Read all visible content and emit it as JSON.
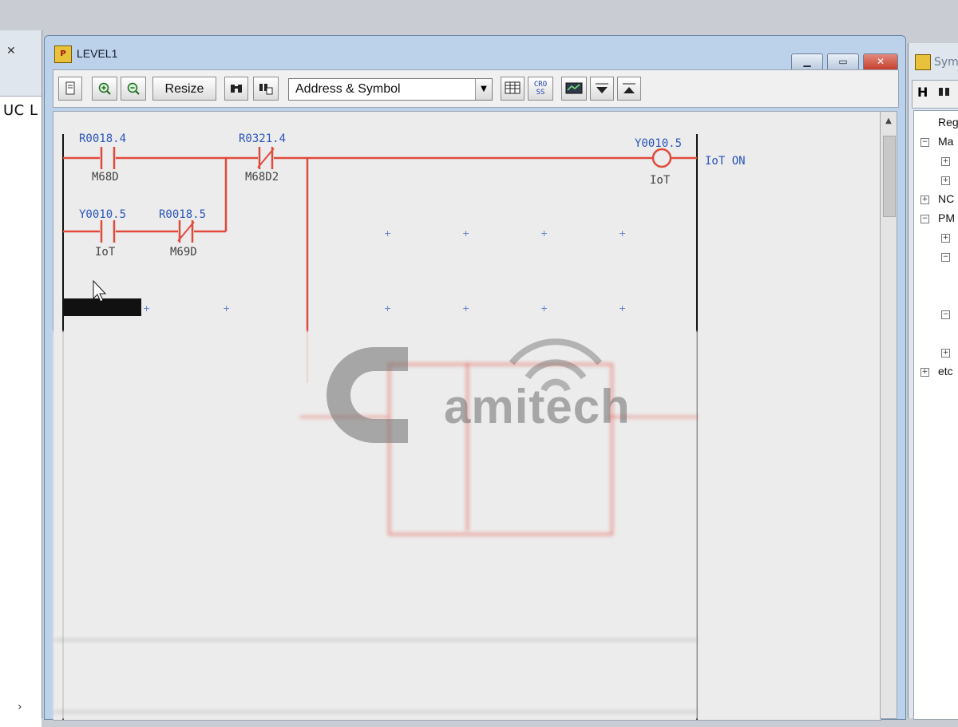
{
  "left_window": {
    "title": "UC L",
    "close_icon": "close-icon",
    "scroll_arrow": "chevron-right-icon"
  },
  "main_window": {
    "title": "LEVEL1",
    "app_icon_text": "PMC",
    "window_controls": [
      "minimize",
      "maximize",
      "close"
    ]
  },
  "toolbar": {
    "resize_label": "Resize",
    "view_select": {
      "value": "Address & Symbol"
    },
    "cross_label": "CRO SS",
    "icons": [
      "page-icon",
      "zoom-in-icon",
      "zoom-out-icon",
      "binoculars-icon",
      "find-replace-icon",
      "table-icon",
      "cross-reference-icon",
      "monitor-icon",
      "move-down-icon",
      "move-up-icon"
    ]
  },
  "ladder": {
    "rung1": {
      "contacts": [
        {
          "address": "R0018.4",
          "symbol": "M68D",
          "type": "NO"
        },
        {
          "address": "R0321.4",
          "symbol": "M68D2",
          "type": "NC"
        }
      ],
      "coil": {
        "address": "Y0010.5",
        "symbol": "IoT",
        "comment": "IoT ON"
      },
      "branch_contacts": [
        {
          "address": "Y0010.5",
          "symbol": "IoT",
          "type": "NO"
        },
        {
          "address": "R0018.5",
          "symbol": "M69D",
          "type": "NC"
        }
      ]
    }
  },
  "watermark": {
    "text": "amitech"
  },
  "right_window": {
    "title": "Sym",
    "toolbar_label": "H",
    "tree_items": [
      "Reg",
      "Ma",
      "NC",
      "PM",
      "etc"
    ]
  },
  "colors": {
    "rung": "#e04a3c",
    "address": "#2a55b8",
    "symbol": "#444444",
    "rail": "#111111"
  }
}
